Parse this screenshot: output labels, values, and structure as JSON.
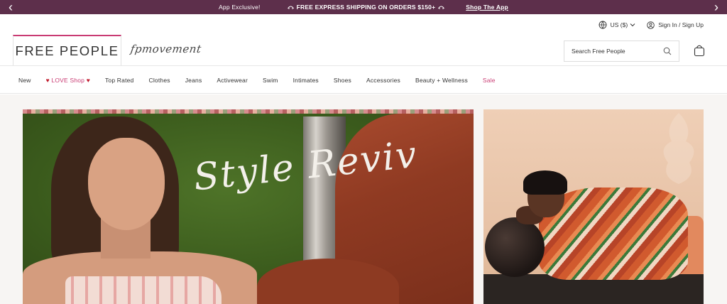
{
  "promo": {
    "messages": [
      "App Exclusive!",
      "FREE EXPRESS SHIPPING ON ORDERS $150+",
      "Shop The App"
    ],
    "prev_icon": "chevron-left-icon",
    "next_icon": "chevron-right-icon",
    "bg_color": "#5d2f4b"
  },
  "utility": {
    "currency": "US ($)",
    "account": "Sign In / Sign Up"
  },
  "header": {
    "logo": "FREE PEOPLE",
    "sub_brand": "fpmovement",
    "search_placeholder": "Search Free People",
    "accent_color": "#c93b73"
  },
  "nav": {
    "items": [
      "New",
      "LOVE Shop",
      "Top Rated",
      "Clothes",
      "Jeans",
      "Activewear",
      "Swim",
      "Intimates",
      "Shoes",
      "Accessories",
      "Beauty + Wellness",
      "Sale"
    ],
    "love_heart": "♥"
  },
  "hero": {
    "headline": "Style Revival"
  }
}
